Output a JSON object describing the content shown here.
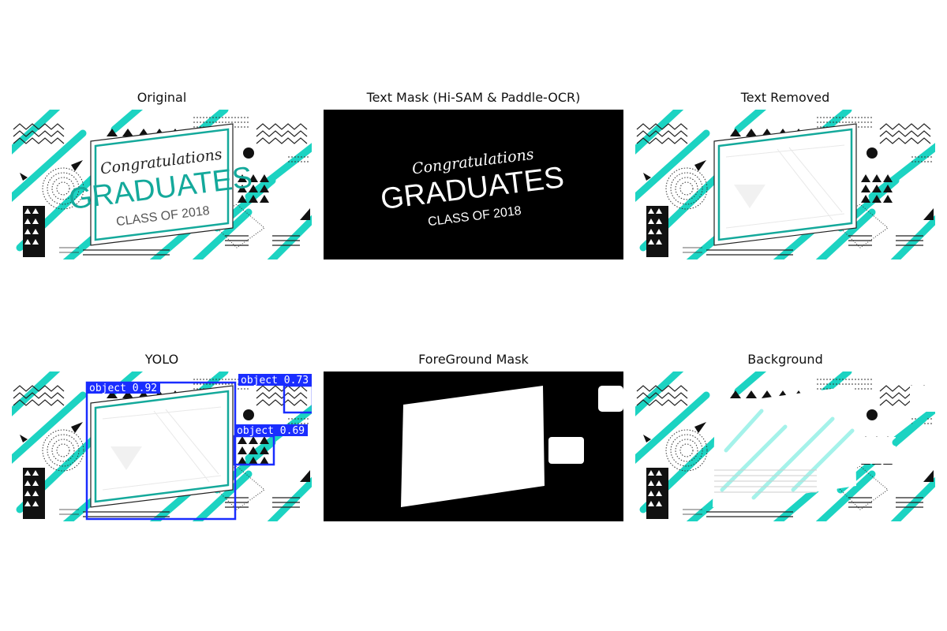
{
  "panels": [
    {
      "title": "Original"
    },
    {
      "title": "Text Mask (Hi-SAM & Paddle-OCR)"
    },
    {
      "title": "Text Removed"
    },
    {
      "title": "YOLO"
    },
    {
      "title": "ForeGround Mask"
    },
    {
      "title": "Background"
    }
  ],
  "card_text": {
    "line1": "Congratulations",
    "line2": "GRADUATES",
    "line3": "CLASS OF 2018"
  },
  "detections": [
    {
      "label": "object 0.92"
    },
    {
      "label": "object 0.73"
    },
    {
      "label": "object 0.69"
    }
  ],
  "colors": {
    "teal": "#1cd3c2",
    "box_blue": "#1a2dff",
    "mask_black": "#000000",
    "mask_white": "#ffffff"
  }
}
